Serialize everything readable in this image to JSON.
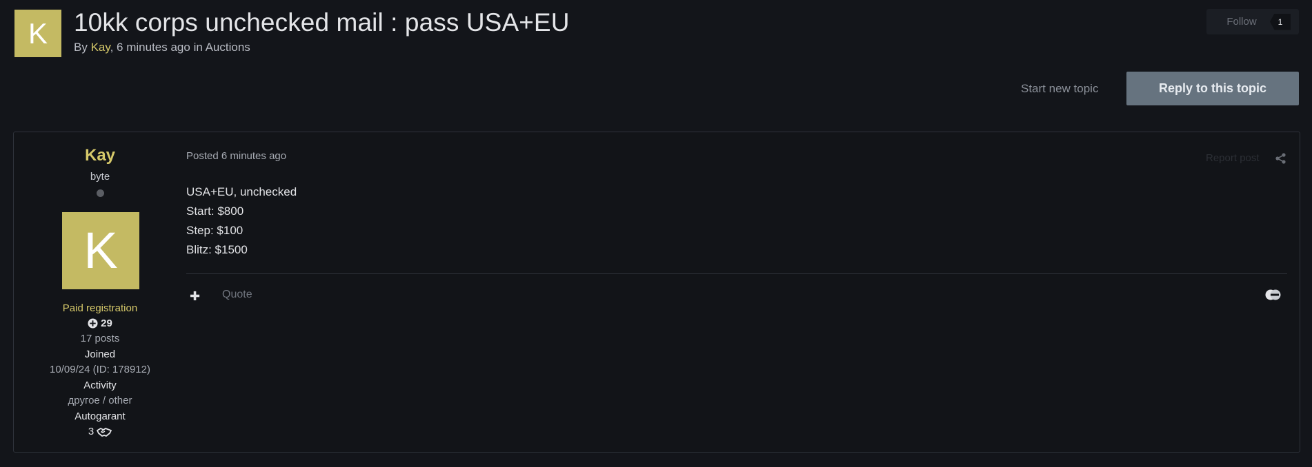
{
  "header": {
    "avatar_letter": "K",
    "title": "10kk corps unchecked mail : pass USA+EU",
    "meta_by": "By ",
    "meta_author": "Kay",
    "meta_rest": ", 6 minutes ago in ",
    "meta_forum": "Auctions",
    "follow_label": "Follow",
    "follow_count": "1"
  },
  "actions": {
    "start_new_topic": "Start new topic",
    "reply": "Reply to this topic"
  },
  "post": {
    "author": {
      "name": "Kay",
      "rank": "byte",
      "avatar_letter": "K",
      "group": "Paid registration",
      "reputation": "29",
      "posts": "17 posts",
      "joined_label": "Joined",
      "joined_value": "10/09/24 (ID: 178912)",
      "activity_label": "Activity",
      "activity_value": "другое / other",
      "autogarant_label": "Autogarant",
      "autogarant_value": "3"
    },
    "posted": "Posted 6 minutes ago",
    "report": "Report post",
    "lines": [
      "USA+EU, unchecked",
      "Start: $800",
      "Step: $100",
      "Blitz: $1500"
    ],
    "quote": "Quote"
  },
  "colors": {
    "background": "#13151a",
    "accent_gold": "#d6c96a",
    "avatar_bg": "#c4ba63",
    "reply_button": "#66737f"
  },
  "icons": {
    "reputation": "plus-circle-icon",
    "autogarant": "handshake-icon",
    "share": "share-icon",
    "add": "plus-icon",
    "multiquote": "multiquote-icon"
  }
}
